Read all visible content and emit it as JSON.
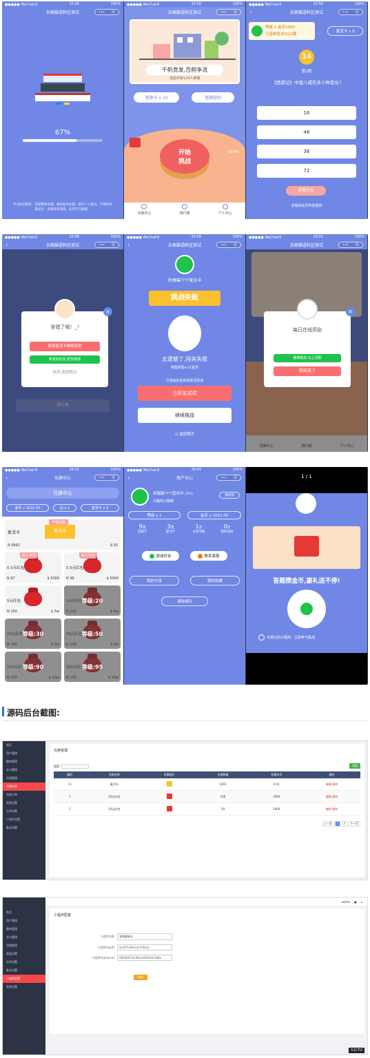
{
  "status": {
    "carrier": "●●●●● WeChat令",
    "battery": "100%"
  },
  "app_title": "杂佩猫语料区测试",
  "capsule": {
    "dots": "•••",
    "close": "⦿"
  },
  "p1": {
    "time": "15:56",
    "progress": "67%",
    "progress_value": 0.67,
    "tip": "专注知识解答、答题赛事主题。紧扣知识主题，提升个人能力。严格的考题设计，多题多答完成。任何学习题目。"
  },
  "p2": {
    "time": "15:56",
    "banner_title": "千帆竞发,百舸争流",
    "banner_sub": "当前共有124人参赛",
    "card_btn": "答题卡 x 10",
    "rule_btn": "答题规则",
    "start": "开始\n挑战",
    "timer": "00:43",
    "tabs": [
      "兑换中心",
      "排行榜",
      "个人中心"
    ]
  },
  "p3": {
    "time": "15:56",
    "level": "等级:1 金币1000",
    "progress_line": "已连续答对3/12题",
    "card_badge": "复活卡 x 3",
    "num": "14",
    "round": "第1题",
    "question": "《西游记》中猪八戒有多少种变化?",
    "options": [
      "16",
      "46",
      "36",
      "72"
    ],
    "help": "求救好友",
    "source": "本题由会员宋佳提供"
  },
  "p4": {
    "time": "15:56",
    "title": "答错了哦！_!",
    "btn_revive": "使用复活卡继续答题",
    "btn_share": "转发给好友,帮你答题",
    "quit": "放弃,我想跳过",
    "bg_btn": "排行榜"
  },
  "p5": {
    "time": "15:59",
    "nick": "奇偶猫????营业中",
    "ribbon": "挑战失败",
    "msg": "太遗憾了,闯关失败",
    "reward": "答题奖励+21金币",
    "hint": "分享给好友获得复活机会",
    "btn_again": "让好友试试",
    "btn_continue": "继续挑战",
    "back_home": "返回首页"
  },
  "p6": {
    "time": "16:01",
    "title": "每日在线奖励",
    "btn_take": "继续挑战 马上领取",
    "btn_ok": "我知道了",
    "tabs": [
      "兑换中心",
      "排行榜",
      "个人中心"
    ]
  },
  "p7": {
    "time": "16:01",
    "page": "兑换中心",
    "heading": "兑换中心",
    "stats": [
      "金币 x 1021.00",
      "钻 x 1",
      "复活卡 x 3"
    ],
    "hot": "千载兑换",
    "hot_card": "复活卡",
    "hot_coupon": "复活卡",
    "hot_n": "N 9962",
    "hot_price": "$.50",
    "items": [
      {
        "title": "0.5元红包",
        "tag": "新人专享",
        "n": "N 97",
        "price": "$ 5000",
        "locked": false
      },
      {
        "title": "0.5元红包",
        "tag": "新人专享",
        "n": "N 99",
        "price": "$ 5000",
        "locked": false
      },
      {
        "title": "5元红包",
        "tag": "",
        "n": "N 100",
        "price": "$ 5w",
        "locked": false
      },
      {
        "title": "10元红包",
        "tag": "",
        "n": "N 100",
        "price": "$ 5w",
        "locked": true,
        "lock": "等级:20"
      },
      {
        "title": "20元红包",
        "tag": "",
        "n": "N 100",
        "price": "$ 5w",
        "locked": true,
        "lock": "等级:30"
      },
      {
        "title": "50元红包",
        "tag": "",
        "n": "N 100",
        "price": "$ 5w",
        "locked": true,
        "lock": "等级:50"
      },
      {
        "title": "100元红包",
        "tag": "",
        "n": "N 100",
        "price": "$ 10w",
        "locked": true,
        "lock": "等级:90"
      },
      {
        "title": "200元红包",
        "tag": "",
        "n": "N 100",
        "price": "$ 20w",
        "locked": true,
        "lock": "等级:95"
      }
    ]
  },
  "p8": {
    "time": "16:01",
    "page": "用户中心",
    "nick": "奇偶猫????营业中 (21)",
    "sub": "兴趣的小鹦鹉",
    "signin": "我的钱",
    "level": "等级 x 1",
    "coins": "金币 x 1021.00",
    "counts": [
      {
        "n": "9",
        "unit": "张",
        "label": "答题卡"
      },
      {
        "n": "3",
        "unit": "张",
        "label": "复活卡"
      },
      {
        "n": "1",
        "unit": "次",
        "label": "分享次数"
      },
      {
        "n": "0",
        "unit": "次",
        "label": "我的闯关"
      }
    ],
    "invite": "邀请好友",
    "service": "联系客服",
    "share": "我的分享",
    "wrong": "我的收藏",
    "clear": "清除缓存"
  },
  "p9": {
    "pager": "1 / 1",
    "slogan": "答题攒金币,豪礼送不停!",
    "hint": "长按识别小程序，立即参与挑战"
  },
  "section_title": "源码后台截图:",
  "admin1": {
    "title": "兑换管理",
    "search_label": "搜索:",
    "add_btn": "添加",
    "menu": [
      "首页",
      "用户管理",
      "题库管理",
      "关卡管理",
      "兑换管理",
      "兑换列表",
      "兑换订单",
      "奖励设置",
      "分享设置",
      "小程序设置",
      "基本设置"
    ],
    "columns": [
      "编号",
      "兑换名称",
      "兑换图片",
      "兑换数量",
      "所需金币",
      "操作"
    ],
    "rows": [
      [
        "11",
        "复活卡",
        "",
        "1001",
        "0.01",
        "编辑 删除"
      ],
      [
        "3",
        "20元红包",
        "",
        "100",
        "2000",
        "编辑 删除"
      ],
      [
        "2",
        "10元红包",
        "",
        "50",
        "1000",
        "编辑 删除"
      ]
    ],
    "pager": [
      "上一页",
      "1",
      "2",
      "下一页"
    ]
  },
  "admin2": {
    "title": "小程序配置",
    "fields": [
      {
        "label": "小程序名称",
        "value": "答题赢豪礼"
      },
      {
        "label": "小程序AppID",
        "value": "wx5f7ce9e1ac7c0b1a"
      },
      {
        "label": "小程序AppSecret",
        "value": "29f4b07c5c48cad2643dc308a"
      }
    ],
    "save": "保存",
    "menu": [
      "首页",
      "用户管理",
      "题库管理",
      "关卡管理",
      "兑换管理",
      "奖励设置",
      "分享设置",
      "基本设置",
      "小程序配置",
      "其他设置"
    ],
    "top_user": "admin"
  },
  "watermark": "51CTO",
  "colors": {
    "primary": "#7087e6",
    "red": "#fa6e71",
    "green": "#1fc24b",
    "gold": "#fbc02d"
  }
}
